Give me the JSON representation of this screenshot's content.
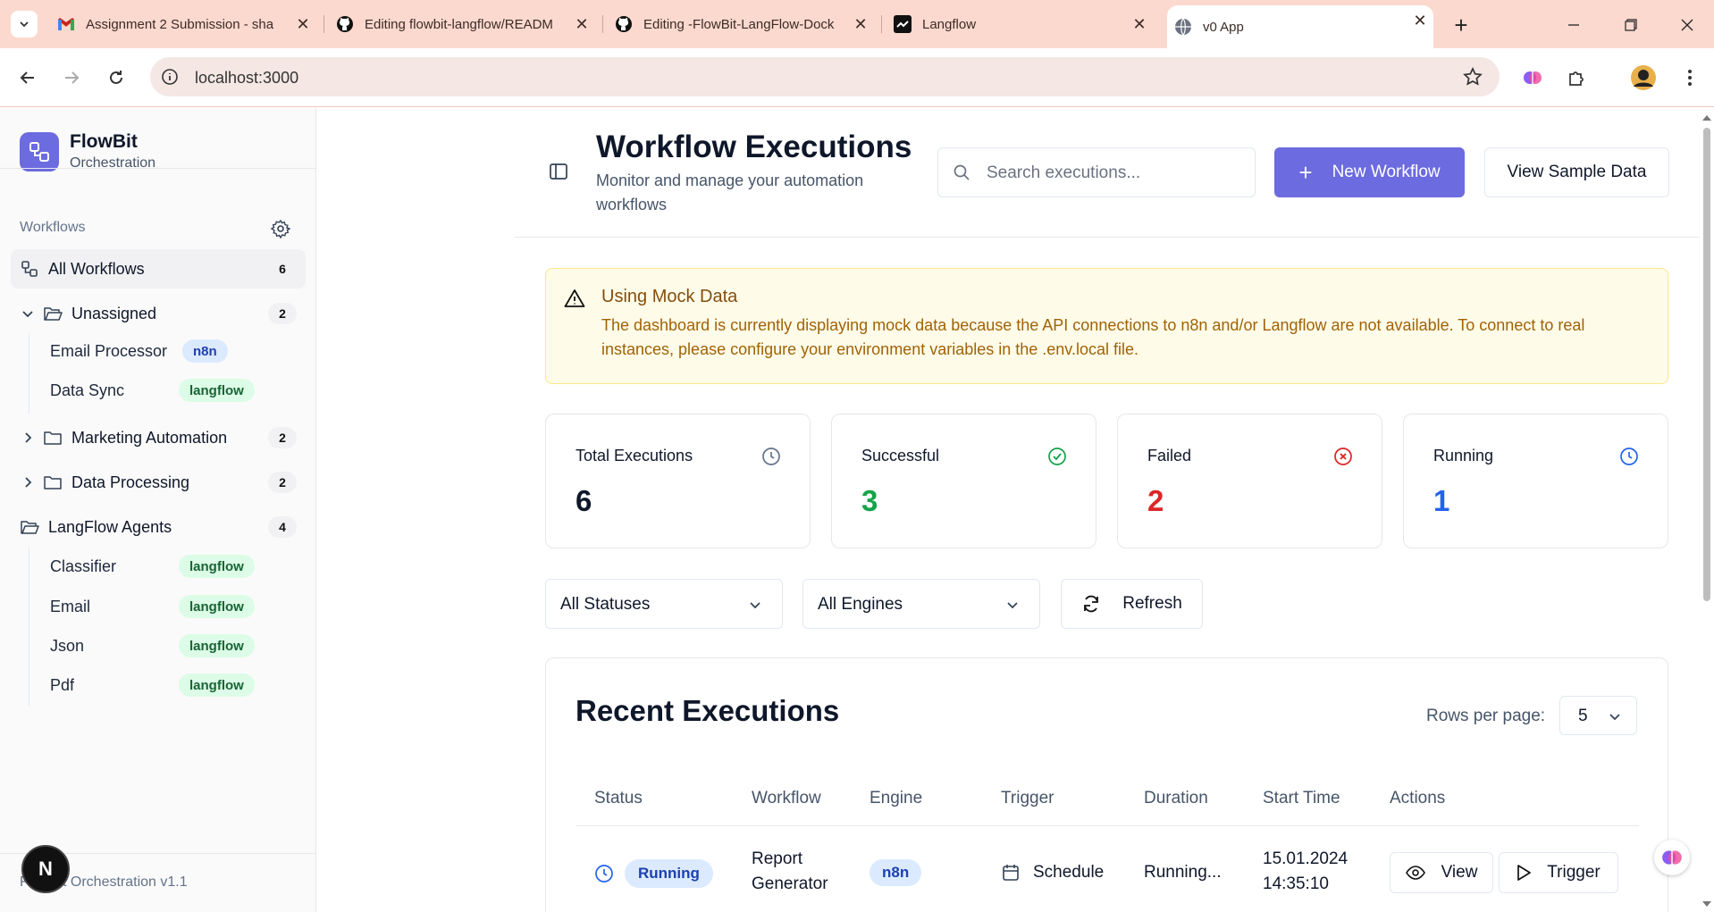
{
  "browser": {
    "tabs": [
      {
        "title": "Assignment 2 Submission - sha",
        "icon": "gmail-icon"
      },
      {
        "title": "Editing flowbit-langflow/READM",
        "icon": "github-icon"
      },
      {
        "title": "Editing -FlowBit-LangFlow-Dock",
        "icon": "github-icon"
      },
      {
        "title": "Langflow",
        "icon": "langflow-icon"
      },
      {
        "title": "v0 App",
        "icon": "globe-icon"
      }
    ],
    "url": "localhost:3000"
  },
  "sidebar": {
    "brand_name": "FlowBit",
    "brand_sub": "Orchestration",
    "section_label": "Workflows",
    "all_workflows": {
      "label": "All Workflows",
      "count": "6"
    },
    "groups": [
      {
        "label": "Unassigned",
        "count": "2",
        "expanded": true,
        "items": [
          {
            "label": "Email Processor",
            "engine": "n8n"
          },
          {
            "label": "Data Sync",
            "engine": "langflow"
          }
        ]
      },
      {
        "label": "Marketing Automation",
        "count": "2",
        "expanded": false
      },
      {
        "label": "Data Processing",
        "count": "2",
        "expanded": false
      },
      {
        "label": "LangFlow Agents",
        "count": "4",
        "expanded": true,
        "items": [
          {
            "label": "Classifier",
            "engine": "langflow"
          },
          {
            "label": "Email",
            "engine": "langflow"
          },
          {
            "label": "Json",
            "engine": "langflow"
          },
          {
            "label": "Pdf",
            "engine": "langflow"
          }
        ]
      }
    ],
    "footer": "FlowBit Orchestration v1.1",
    "next_badge": "N"
  },
  "header": {
    "title": "Workflow Executions",
    "subtitle": "Monitor and manage your automation workflows",
    "search_placeholder": "Search executions...",
    "new_workflow": "New Workflow",
    "view_sample": "View Sample Data"
  },
  "alert": {
    "title": "Using Mock Data",
    "description": "The dashboard is currently displaying mock data because the API connections to n8n and/or Langflow are not available. To connect to real instances, please configure your environment variables in the .env.local file."
  },
  "stats": [
    {
      "label": "Total Executions",
      "value": "6",
      "color": "#0f172a",
      "icon": "clock-icon"
    },
    {
      "label": "Successful",
      "value": "3",
      "color": "#16a34a",
      "icon": "check-circle-icon"
    },
    {
      "label": "Failed",
      "value": "2",
      "color": "#dc2626",
      "icon": "x-circle-icon"
    },
    {
      "label": "Running",
      "value": "1",
      "color": "#2563eb",
      "icon": "clock-icon"
    }
  ],
  "filters": {
    "status": "All Statuses",
    "engine": "All Engines",
    "refresh": "Refresh"
  },
  "executions": {
    "title": "Recent Executions",
    "rows_per_page_label": "Rows per page:",
    "rows_per_page": "5",
    "columns": [
      "Status",
      "Workflow",
      "Engine",
      "Trigger",
      "Duration",
      "Start Time",
      "Actions"
    ],
    "rows": [
      {
        "status": "Running",
        "workflow_l1": "Report",
        "workflow_l2": "Generator",
        "engine": "n8n",
        "trigger": "Schedule",
        "duration": "Running...",
        "start_date": "15.01.2024",
        "start_time": "14:35:10",
        "view": "View",
        "trigger_btn": "Trigger"
      }
    ]
  }
}
